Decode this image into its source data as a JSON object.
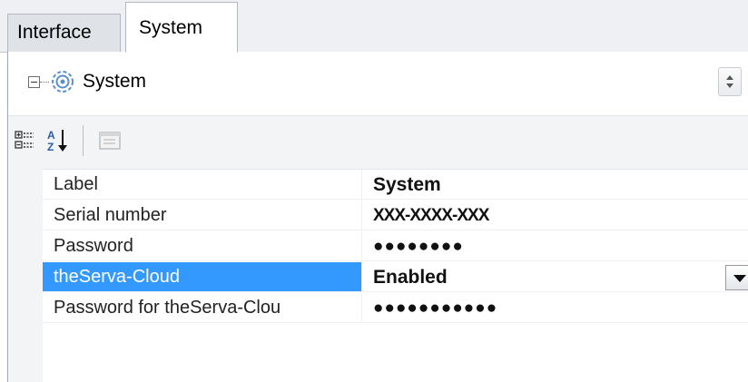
{
  "tabs": [
    {
      "label": "Interface",
      "active": false
    },
    {
      "label": "System",
      "active": true
    }
  ],
  "object_selector": {
    "title": "System",
    "icon": "gear-icon",
    "expander": "collapse"
  },
  "toolbar": {
    "buttons": [
      "categorized-view-icon",
      "alphabetical-sort-icon",
      "property-pages-icon"
    ]
  },
  "properties": [
    {
      "name": "Label",
      "value": "System"
    },
    {
      "name": "Serial number",
      "value": "XXX-XXXX-XXX"
    },
    {
      "name": "Password",
      "value": "●●●●●●●●"
    },
    {
      "name": "theServa-Cloud",
      "value": "Enabled",
      "selected": true
    },
    {
      "name": "Password for theServa-Clou",
      "value": "●●●●●●●●●●●"
    }
  ],
  "colors": {
    "selection": "#3399ff",
    "toolbar_bg": "#f2f4f6",
    "tabstrip_bg": "#eef0f3"
  }
}
